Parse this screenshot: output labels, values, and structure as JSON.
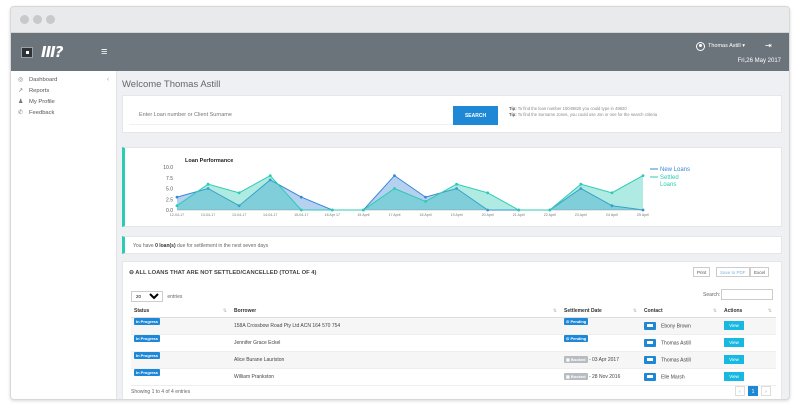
{
  "header": {
    "logo_text": "III?",
    "user_name": "Thomas Astill",
    "date": "Fri,26 May 2017"
  },
  "sidebar": {
    "items": [
      {
        "label": "Dashboard",
        "icon": "dashboard-icon"
      },
      {
        "label": "Reports",
        "icon": "chart-icon"
      },
      {
        "label": "My Profile",
        "icon": "user-icon"
      },
      {
        "label": "Feedback",
        "icon": "feedback-icon"
      }
    ]
  },
  "main": {
    "welcome": "Welcome Thomas Astill",
    "search": {
      "placeholder": "Enter Loan number or Client Surname",
      "button": "SEARCH",
      "tip1_label": "Tip:",
      "tip1_text": "To find the loan number 10049820 you could type in 49820",
      "tip2_label": "Tip:",
      "tip2_text": "To find the Surname Jones, you could use Jon or one for the search criteria"
    },
    "notice": {
      "prefix": "You have",
      "count_text": "0 loan(s)",
      "suffix": "due for settlement in the next seven days"
    }
  },
  "chart_data": {
    "type": "area",
    "title": "Loan Performance",
    "categories": [
      "12-04-17",
      "13-04-17",
      "13-04-17",
      "14-04-17",
      "15-04-17",
      "16 Apr 17",
      "15 April",
      "17 April",
      "18 April",
      "19 April",
      "20 April",
      "21 April",
      "22 April",
      "23 April",
      "24 April",
      "25 April"
    ],
    "yticks": [
      "10.0",
      "7.5",
      "5.0",
      "2.5",
      "0.0"
    ],
    "ylim": [
      0,
      10
    ],
    "legend_position": "right",
    "series": [
      {
        "name": "New Loans",
        "color": "#3a87d8",
        "values": [
          3,
          5,
          1,
          7,
          3,
          0,
          0,
          8,
          3,
          5,
          0,
          0,
          0,
          5,
          1,
          0
        ]
      },
      {
        "name": "Settled Loans",
        "color": "#2ccbb3",
        "values": [
          1,
          6,
          4,
          8,
          0,
          0,
          0,
          5,
          2,
          6,
          4,
          0,
          0,
          6,
          4,
          8
        ]
      }
    ]
  },
  "loans": {
    "title": "ALL LOANS THAT ARE NOT SETTLED/CANCELLED (TOTAL OF 4)",
    "buttons": {
      "print": "Print",
      "pdf": "Save to PDF",
      "excel": "Excel"
    },
    "entries_value": "20",
    "entries_label": "entries",
    "search_label": "Search:",
    "columns": [
      "Status",
      "Borrower",
      "Settlement Date",
      "Contact",
      "Actions"
    ],
    "rows": [
      {
        "status": "In Progress",
        "borrower": "158A Crossbow Road Pty Ltd ACN 164 570 754",
        "settlement_badge": "Pending",
        "settlement_date": "",
        "contact": "Ebony Brown",
        "action": "View"
      },
      {
        "status": "In Progress",
        "borrower": "Jennifer Grace Eckel",
        "settlement_badge": "Pending",
        "settlement_date": "",
        "contact": "Thomas Astill",
        "action": "View"
      },
      {
        "status": "In Progress",
        "borrower": "Alice Burane Lauriston",
        "settlement_badge": "Booked",
        "settlement_date": "- 03 Apr 2017",
        "contact": "Thomas Astill",
        "action": "View"
      },
      {
        "status": "In Progress",
        "borrower": "William Prankston",
        "settlement_badge": "Booked",
        "settlement_date": "- 28 Nov 2016",
        "contact": "Elle Marsh",
        "action": "View"
      }
    ],
    "showing": "Showing 1 to 4 of 4 entries",
    "pager": {
      "prev": "‹",
      "page": "1",
      "next": "›"
    }
  }
}
